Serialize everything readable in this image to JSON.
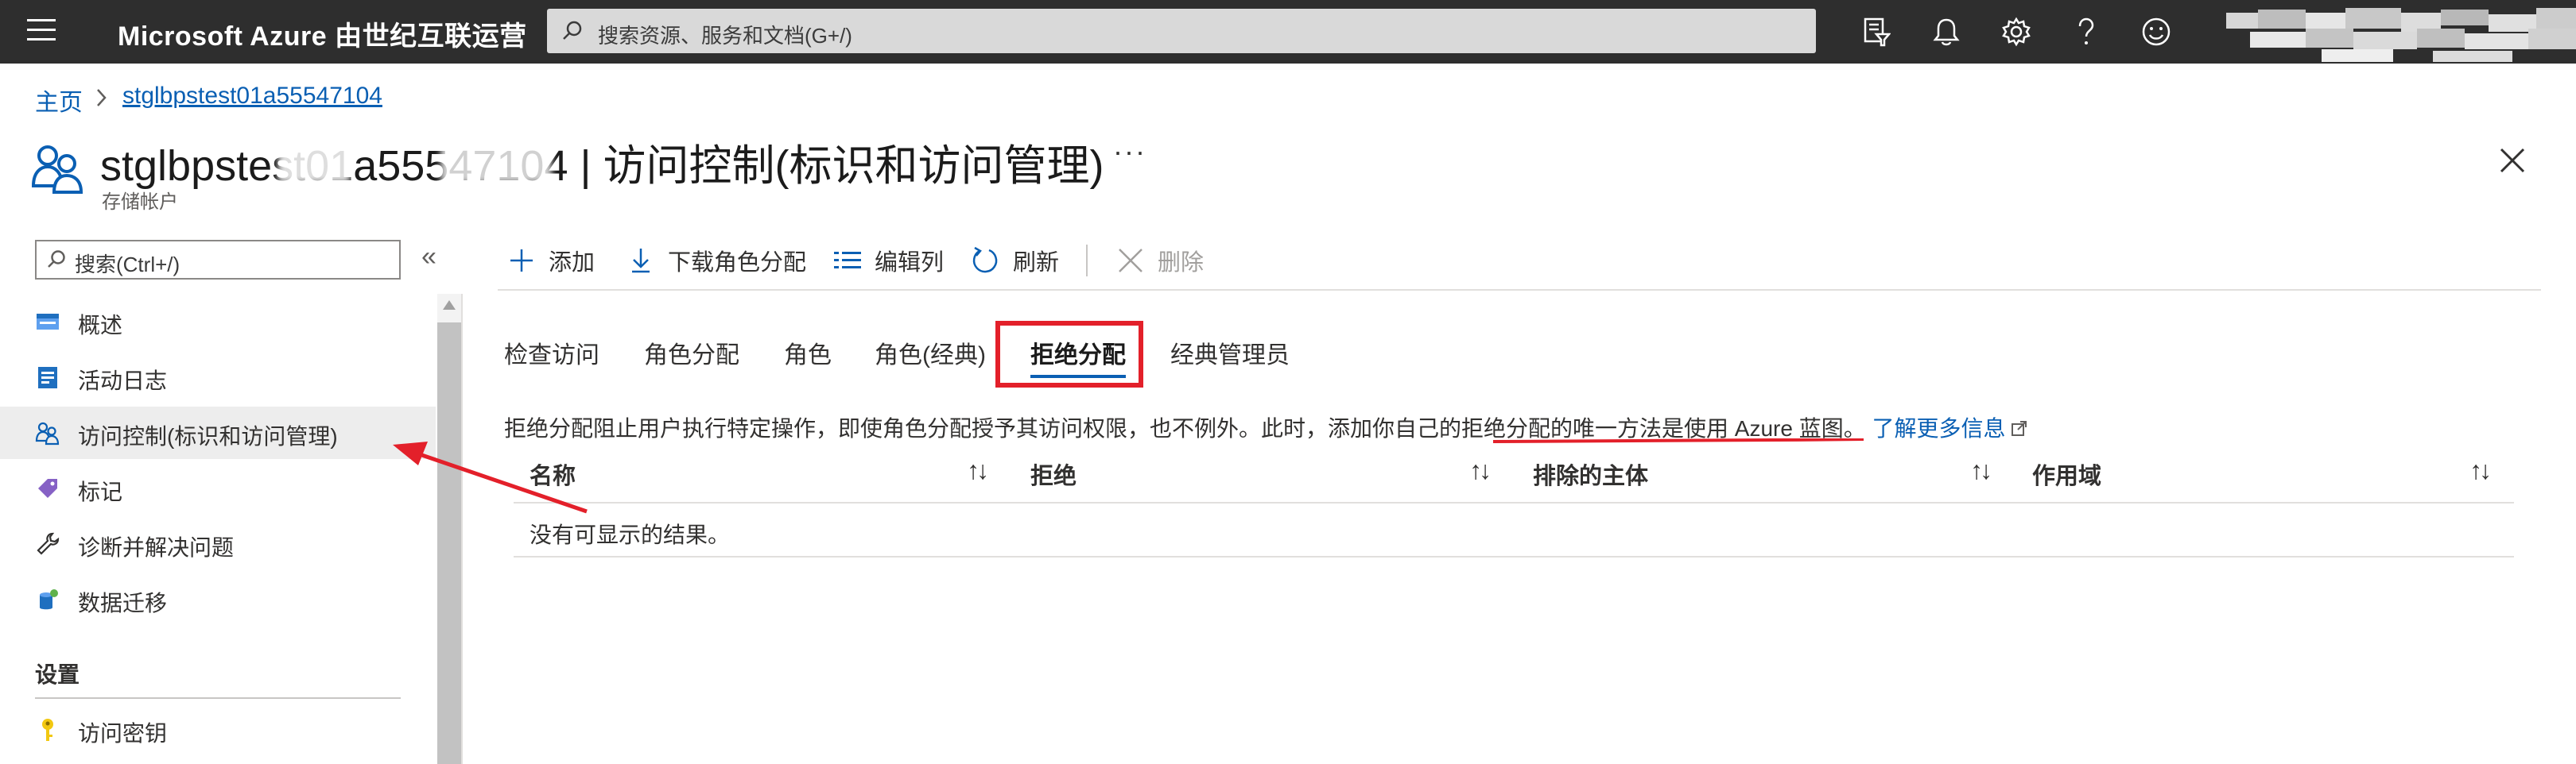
{
  "topbar": {
    "brand": "Microsoft Azure 由世纪互联运营",
    "search_placeholder": "搜索资源、服务和文档(G+/)",
    "icons": [
      "menu-icon",
      "cloud-shell-filter-icon",
      "notifications-bell-icon",
      "settings-gear-icon",
      "help-question-icon",
      "feedback-smiley-icon"
    ]
  },
  "breadcrumb": {
    "home": "主页",
    "resource": "stglbpstest01a55547104"
  },
  "header": {
    "title": "stglbpstest01a55547104 | 访问控制(标识和访问管理)",
    "subtitle": "存储帐户",
    "more": "···"
  },
  "sidebar": {
    "search_placeholder": "搜索(Ctrl+/)",
    "collapse": "«",
    "items": [
      {
        "label": "概述",
        "icon": "overview-icon"
      },
      {
        "label": "活动日志",
        "icon": "activity-log-icon"
      },
      {
        "label": "访问控制(标识和访问管理)",
        "icon": "access-control-users-icon"
      },
      {
        "label": "标记",
        "icon": "tag-icon"
      },
      {
        "label": "诊断并解决问题",
        "icon": "wrench-icon"
      },
      {
        "label": "数据迁移",
        "icon": "data-migration-icon"
      }
    ],
    "section_settings": "设置",
    "settings_items": [
      {
        "label": "访问密钥",
        "icon": "key-icon"
      }
    ]
  },
  "commands": {
    "add": "添加",
    "download": "下载角色分配",
    "edit_columns": "编辑列",
    "refresh": "刷新",
    "delete": "删除"
  },
  "tabs": [
    {
      "label": "检查访问"
    },
    {
      "label": "角色分配"
    },
    {
      "label": "角色"
    },
    {
      "label": "角色(经典)"
    },
    {
      "label": "拒绝分配"
    },
    {
      "label": "经典管理员"
    }
  ],
  "description": {
    "text": "拒绝分配阻止用户执行特定操作，即使角色分配授予其访问权限，也不例外。此时，添加你自己的拒绝分配的唯一方法是使用 Azure 蓝图。",
    "link": "了解更多信息"
  },
  "grid": {
    "columns": [
      "名称",
      "拒绝",
      "排除的主体",
      "作用域"
    ],
    "sort_glyph": "↑↓",
    "empty_message": "没有可显示的结果。"
  },
  "colors": {
    "topbar_bg": "#2e2e2e",
    "link_blue": "#0a5fb3",
    "annotation_red": "#e3202a",
    "selected_nav_bg": "#ededed"
  }
}
